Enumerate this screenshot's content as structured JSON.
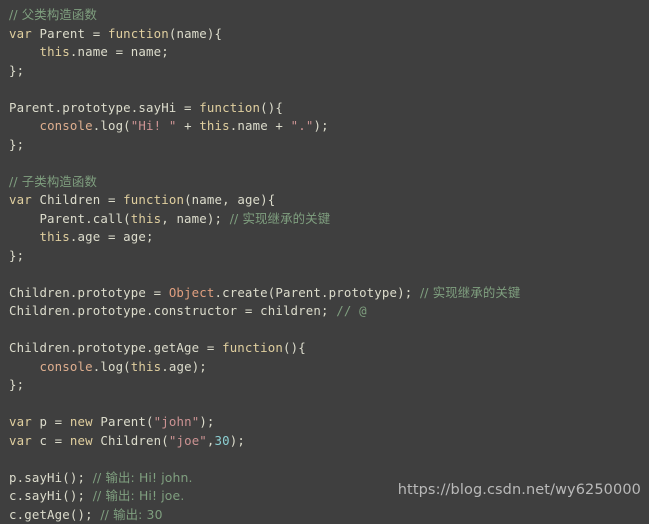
{
  "editor": {
    "theme_name": "zenburn-dark",
    "language": "javascript",
    "background_color": "#3f3f3f",
    "default_text_color": "#dcdccc",
    "token_colors": {
      "comment": "#7f9f7f",
      "keyword": "#e0cf9f",
      "string": "#cc9393",
      "number": "#8cd0d3",
      "builtin": "#dfaf8f",
      "type": "#e09f7f",
      "plain": "#dcdccc"
    }
  },
  "watermark": {
    "text": "https://blog.csdn.net/wy6250000",
    "color": "#b9b9b9"
  },
  "code": {
    "lines": [
      {
        "tokens": [
          {
            "t": "// 父类构造函数",
            "c": "comment"
          }
        ]
      },
      {
        "tokens": [
          {
            "t": "var",
            "c": "keyword"
          },
          {
            "t": " Parent = ",
            "c": "plain"
          },
          {
            "t": "function",
            "c": "keyword"
          },
          {
            "t": "(name){",
            "c": "plain"
          }
        ]
      },
      {
        "tokens": [
          {
            "t": "    ",
            "c": "plain"
          },
          {
            "t": "this",
            "c": "keyword"
          },
          {
            "t": ".name = name;",
            "c": "plain"
          }
        ]
      },
      {
        "tokens": [
          {
            "t": "};",
            "c": "plain"
          }
        ]
      },
      {
        "tokens": []
      },
      {
        "tokens": [
          {
            "t": "Parent.prototype.sayHi = ",
            "c": "plain"
          },
          {
            "t": "function",
            "c": "keyword"
          },
          {
            "t": "(){",
            "c": "plain"
          }
        ]
      },
      {
        "tokens": [
          {
            "t": "    ",
            "c": "plain"
          },
          {
            "t": "console",
            "c": "builtin"
          },
          {
            "t": ".log(",
            "c": "plain"
          },
          {
            "t": "\"Hi! \"",
            "c": "string"
          },
          {
            "t": " + ",
            "c": "plain"
          },
          {
            "t": "this",
            "c": "keyword"
          },
          {
            "t": ".name + ",
            "c": "plain"
          },
          {
            "t": "\".\"",
            "c": "string"
          },
          {
            "t": ");",
            "c": "plain"
          }
        ]
      },
      {
        "tokens": [
          {
            "t": "};",
            "c": "plain"
          }
        ]
      },
      {
        "tokens": []
      },
      {
        "tokens": [
          {
            "t": "// 子类构造函数",
            "c": "comment"
          }
        ]
      },
      {
        "tokens": [
          {
            "t": "var",
            "c": "keyword"
          },
          {
            "t": " Children = ",
            "c": "plain"
          },
          {
            "t": "function",
            "c": "keyword"
          },
          {
            "t": "(name, age){",
            "c": "plain"
          }
        ]
      },
      {
        "tokens": [
          {
            "t": "    Parent.call(",
            "c": "plain"
          },
          {
            "t": "this",
            "c": "keyword"
          },
          {
            "t": ", name); ",
            "c": "plain"
          },
          {
            "t": "// 实现继承的关键",
            "c": "comment"
          }
        ]
      },
      {
        "tokens": [
          {
            "t": "    ",
            "c": "plain"
          },
          {
            "t": "this",
            "c": "keyword"
          },
          {
            "t": ".age = age;",
            "c": "plain"
          }
        ]
      },
      {
        "tokens": [
          {
            "t": "};",
            "c": "plain"
          }
        ]
      },
      {
        "tokens": []
      },
      {
        "tokens": [
          {
            "t": "Children.prototype = ",
            "c": "plain"
          },
          {
            "t": "Object",
            "c": "type"
          },
          {
            "t": ".create(Parent.prototype); ",
            "c": "plain"
          },
          {
            "t": "// 实现继承的关键",
            "c": "comment"
          }
        ]
      },
      {
        "tokens": [
          {
            "t": "Children.prototype.constructor = children; ",
            "c": "plain"
          },
          {
            "t": "// @",
            "c": "comment"
          }
        ]
      },
      {
        "tokens": []
      },
      {
        "tokens": [
          {
            "t": "Children.prototype.getAge = ",
            "c": "plain"
          },
          {
            "t": "function",
            "c": "keyword"
          },
          {
            "t": "(){",
            "c": "plain"
          }
        ]
      },
      {
        "tokens": [
          {
            "t": "    ",
            "c": "plain"
          },
          {
            "t": "console",
            "c": "builtin"
          },
          {
            "t": ".log(",
            "c": "plain"
          },
          {
            "t": "this",
            "c": "keyword"
          },
          {
            "t": ".age);",
            "c": "plain"
          }
        ]
      },
      {
        "tokens": [
          {
            "t": "};",
            "c": "plain"
          }
        ]
      },
      {
        "tokens": []
      },
      {
        "tokens": [
          {
            "t": "var",
            "c": "keyword"
          },
          {
            "t": " p = ",
            "c": "plain"
          },
          {
            "t": "new",
            "c": "keyword"
          },
          {
            "t": " Parent(",
            "c": "plain"
          },
          {
            "t": "\"john\"",
            "c": "string"
          },
          {
            "t": ");",
            "c": "plain"
          }
        ]
      },
      {
        "tokens": [
          {
            "t": "var",
            "c": "keyword"
          },
          {
            "t": " c = ",
            "c": "plain"
          },
          {
            "t": "new",
            "c": "keyword"
          },
          {
            "t": " Children(",
            "c": "plain"
          },
          {
            "t": "\"joe\"",
            "c": "string"
          },
          {
            "t": ",",
            "c": "plain"
          },
          {
            "t": "30",
            "c": "number"
          },
          {
            "t": ");",
            "c": "plain"
          }
        ]
      },
      {
        "tokens": []
      },
      {
        "tokens": [
          {
            "t": "p.sayHi(); ",
            "c": "plain"
          },
          {
            "t": "// 输出: Hi! john.",
            "c": "comment"
          }
        ]
      },
      {
        "tokens": [
          {
            "t": "c.sayHi(); ",
            "c": "plain"
          },
          {
            "t": "// 输出: Hi! joe.",
            "c": "comment"
          }
        ]
      },
      {
        "tokens": [
          {
            "t": "c.getAge(); ",
            "c": "plain"
          },
          {
            "t": "// 输出: 30",
            "c": "comment"
          }
        ]
      }
    ]
  }
}
